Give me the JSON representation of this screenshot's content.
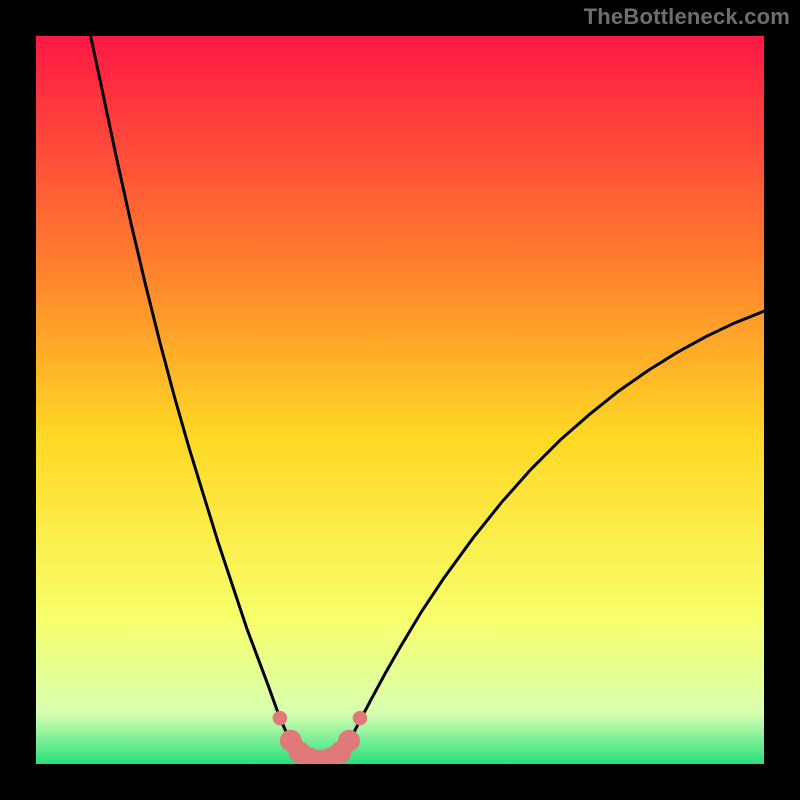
{
  "watermark": "TheBottleneck.com",
  "chart_data": {
    "type": "line",
    "title": "",
    "xlabel": "",
    "ylabel": "",
    "xlim": [
      0,
      100
    ],
    "ylim": [
      0,
      100
    ],
    "gradient_colors": {
      "top": "#ff1846",
      "upper_mid": "#ff7a2e",
      "mid": "#ffd824",
      "lower_mid": "#f7ff6b",
      "near_bottom": "#d8ffb0",
      "bottom": "#27e07e"
    },
    "series": [
      {
        "name": "left-branch",
        "x": [
          7.5,
          9,
          11,
          13,
          15,
          17,
          19,
          21,
          23,
          25,
          27,
          29,
          30.5,
          32,
          33,
          34,
          35,
          36
        ],
        "y": [
          100,
          93,
          83.5,
          74.5,
          66,
          58,
          50.5,
          43.5,
          37,
          30.5,
          24.5,
          18.5,
          14.5,
          10.5,
          7.7,
          5.2,
          3,
          1.2
        ]
      },
      {
        "name": "right-branch",
        "x": [
          42,
          43,
          44,
          46,
          48,
          50,
          53,
          56,
          60,
          64,
          68,
          72,
          76,
          80,
          84,
          88,
          92,
          96,
          100
        ],
        "y": [
          1.2,
          3,
          5,
          8.8,
          12.5,
          16,
          21,
          25.5,
          31,
          36,
          40.5,
          44.5,
          48,
          51.2,
          54,
          56.5,
          58.7,
          60.6,
          62.2
        ]
      }
    ],
    "markers": {
      "name": "bottom-segment",
      "color": "#e07a7a",
      "points": [
        {
          "x": 33.5,
          "y": 6.3,
          "r": 1.0
        },
        {
          "x": 35.0,
          "y": 3.2,
          "r": 1.5
        },
        {
          "x": 36.2,
          "y": 1.6,
          "r": 1.5
        },
        {
          "x": 37.5,
          "y": 0.8,
          "r": 1.5
        },
        {
          "x": 39.0,
          "y": 0.5,
          "r": 1.5
        },
        {
          "x": 40.5,
          "y": 0.8,
          "r": 1.5
        },
        {
          "x": 41.8,
          "y": 1.6,
          "r": 1.5
        },
        {
          "x": 43.0,
          "y": 3.2,
          "r": 1.5
        },
        {
          "x": 44.5,
          "y": 6.3,
          "r": 1.0
        }
      ]
    }
  }
}
